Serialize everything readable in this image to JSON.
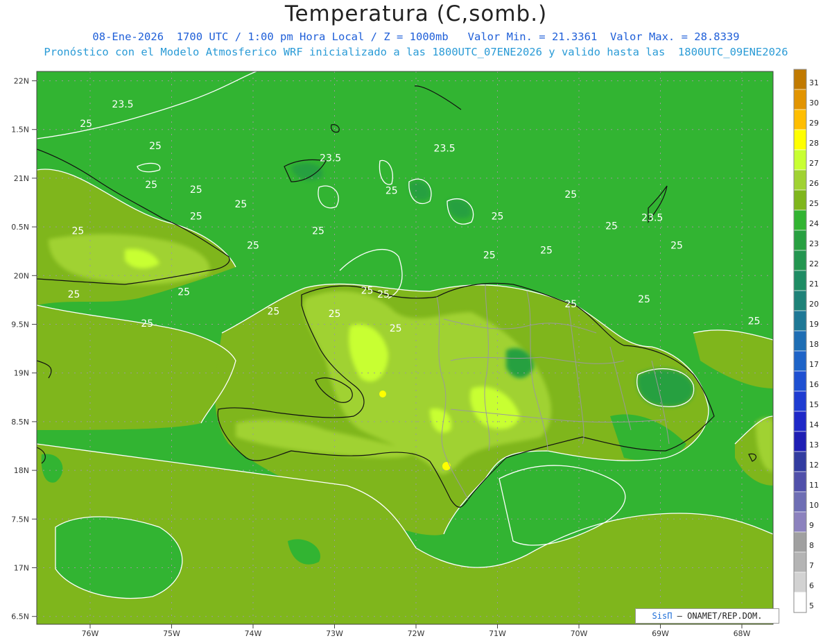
{
  "header": {
    "title": "Temperatura (C,somb.)",
    "line1": "08-Ene-2026  1700 UTC / 1:00 pm Hora Local / Z = 1000mb   Valor Min. = 21.3361  Valor Max. = 28.8339",
    "line2": "Pronóstico con el Modelo Atmosferico WRF inicializado a las 1800UTC_07ENE2026 y valido hasta las  1800UTC_09ENE2026"
  },
  "axes": {
    "lat_labels": [
      "22N",
      "1.5N",
      "21N",
      "0.5N",
      "20N",
      "9.5N",
      "19N",
      "8.5N",
      "18N",
      "7.5N",
      "17N",
      "6.5N"
    ],
    "lon_labels": [
      "76W",
      "75W",
      "74W",
      "73W",
      "72W",
      "71W",
      "70W",
      "69W",
      "68W"
    ]
  },
  "colorbar": {
    "labels": [
      "31",
      "30",
      "29",
      "28",
      "27",
      "26",
      "25",
      "24",
      "23",
      "22",
      "21",
      "20",
      "19",
      "18",
      "17",
      "16",
      "15",
      "14",
      "13",
      "12",
      "11",
      "10",
      "9",
      "8",
      "7",
      "6",
      "5"
    ],
    "colors": [
      "#c17a00",
      "#e29400",
      "#ffbe00",
      "#ffff00",
      "#c8ff32",
      "#a0d232",
      "#7fb61c",
      "#32b432",
      "#28a041",
      "#239650",
      "#1e8c64",
      "#1e8278",
      "#1e7896",
      "#1e6eb4",
      "#1e64c8",
      "#1e50d2",
      "#1e3cd2",
      "#1e28c8",
      "#1e1eb4",
      "#323ca0",
      "#5050aa",
      "#6e6eb4",
      "#8c82be",
      "#a0a0a0",
      "#b4b4b4",
      "#d2d2d2",
      "#ffffff"
    ]
  },
  "contour_labels": [
    {
      "text": "23.5",
      "lon": -75.6,
      "lat": 21.45
    },
    {
      "text": "23.5",
      "lon": -73.05,
      "lat": 20.35
    },
    {
      "text": "23.5",
      "lon": -71.65,
      "lat": 20.55
    },
    {
      "text": "23.5",
      "lon": -69.1,
      "lat": 19.12
    },
    {
      "text": "25",
      "lon": -76.05,
      "lat": 21.05
    },
    {
      "text": "25",
      "lon": -75.2,
      "lat": 20.6
    },
    {
      "text": "25",
      "lon": -75.25,
      "lat": 19.8
    },
    {
      "text": "25",
      "lon": -74.7,
      "lat": 19.7
    },
    {
      "text": "25",
      "lon": -74.15,
      "lat": 19.4
    },
    {
      "text": "25",
      "lon": -74.7,
      "lat": 19.15
    },
    {
      "text": "25",
      "lon": -76.15,
      "lat": 18.85
    },
    {
      "text": "25",
      "lon": -73.2,
      "lat": 18.85
    },
    {
      "text": "25",
      "lon": -74.0,
      "lat": 18.55
    },
    {
      "text": "25",
      "lon": -72.3,
      "lat": 19.68
    },
    {
      "text": "25",
      "lon": -71.0,
      "lat": 19.15
    },
    {
      "text": "25",
      "lon": -70.1,
      "lat": 19.6
    },
    {
      "text": "25",
      "lon": -69.6,
      "lat": 18.95
    },
    {
      "text": "25",
      "lon": -70.4,
      "lat": 18.45
    },
    {
      "text": "25",
      "lon": -71.1,
      "lat": 18.35
    },
    {
      "text": "25",
      "lon": -68.8,
      "lat": 18.55
    },
    {
      "text": "25",
      "lon": -67.5,
      "lat": 19.4
    },
    {
      "text": "25",
      "lon": -72.6,
      "lat": 17.63
    },
    {
      "text": "25",
      "lon": -76.2,
      "lat": 17.55
    },
    {
      "text": "25",
      "lon": -74.85,
      "lat": 17.6
    },
    {
      "text": "25",
      "lon": -72.4,
      "lat": 17.55
    },
    {
      "text": "25",
      "lon": -70.1,
      "lat": 17.35
    },
    {
      "text": "25",
      "lon": -69.2,
      "lat": 17.45
    },
    {
      "text": "25",
      "lon": -73.75,
      "lat": 17.2
    },
    {
      "text": "25",
      "lon": -73.0,
      "lat": 17.15
    },
    {
      "text": "25",
      "lon": -75.3,
      "lat": 16.95
    },
    {
      "text": "25",
      "lon": -72.25,
      "lat": 16.85
    },
    {
      "text": "25",
      "lon": -67.85,
      "lat": 17.0
    }
  ],
  "credit": {
    "sis": "SisΠ",
    "rest": "– ONAMET/REP.DOM."
  }
}
